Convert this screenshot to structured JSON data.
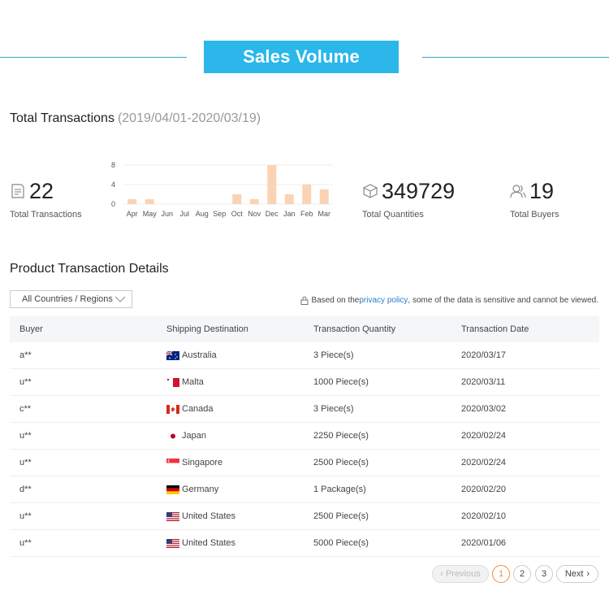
{
  "header": {
    "title": "Sales Volume"
  },
  "transactions": {
    "title": "Total Transactions",
    "date_range": "(2019/04/01-2020/03/19)"
  },
  "stats": {
    "total_transactions": {
      "value": "22",
      "label": "Total Transactions",
      "icon": "document-icon"
    },
    "total_quantities": {
      "value": "349729",
      "label": "Total Quantities",
      "icon": "box-icon"
    },
    "total_buyers": {
      "value": "19",
      "label": "Total Buyers",
      "icon": "users-icon"
    }
  },
  "chart_data": {
    "type": "bar",
    "categories": [
      "Apr",
      "May",
      "Jun",
      "Jul",
      "Aug",
      "Sep",
      "Oct",
      "Nov",
      "Dec",
      "Jan",
      "Feb",
      "Mar"
    ],
    "values": [
      1,
      1,
      0,
      0,
      0,
      0,
      2,
      1,
      8,
      2,
      4,
      3
    ],
    "yticks": [
      "0",
      "4",
      "8"
    ],
    "ylim": [
      0,
      8
    ],
    "grid": true,
    "color": "#fad3b4"
  },
  "details": {
    "title": "Product Transaction Details",
    "region_filter": "All Countries / Regions",
    "privacy": {
      "before": "Based on the ",
      "link": "privacy policy",
      "after": ", some of the data is sensitive and cannot be viewed."
    },
    "columns": [
      "Buyer",
      "Shipping Destination",
      "Transaction Quantity",
      "Transaction Date"
    ],
    "rows": [
      {
        "buyer": "a**",
        "destination": "Australia",
        "flag": "au",
        "quantity": "3 Piece(s)",
        "date": "2020/03/17"
      },
      {
        "buyer": "u**",
        "destination": "Malta",
        "flag": "mt",
        "quantity": "1000 Piece(s)",
        "date": "2020/03/11"
      },
      {
        "buyer": "c**",
        "destination": "Canada",
        "flag": "ca",
        "quantity": "3 Piece(s)",
        "date": "2020/03/02"
      },
      {
        "buyer": "u**",
        "destination": "Japan",
        "flag": "jp",
        "quantity": "2250 Piece(s)",
        "date": "2020/02/24"
      },
      {
        "buyer": "u**",
        "destination": "Singapore",
        "flag": "sg",
        "quantity": "2500 Piece(s)",
        "date": "2020/02/24"
      },
      {
        "buyer": "d**",
        "destination": "Germany",
        "flag": "de",
        "quantity": "1 Package(s)",
        "date": "2020/02/20"
      },
      {
        "buyer": "u**",
        "destination": "United States",
        "flag": "us",
        "quantity": "2500 Piece(s)",
        "date": "2020/02/10"
      },
      {
        "buyer": "u**",
        "destination": "United States",
        "flag": "us",
        "quantity": "5000 Piece(s)",
        "date": "2020/01/06"
      }
    ]
  },
  "pagination": {
    "previous": "Previous",
    "pages": [
      "1",
      "2",
      "3"
    ],
    "current": "1",
    "next": "Next"
  },
  "colors": {
    "accent": "#2bb7ea",
    "link": "#2a7fc9",
    "active_page": "#f08b3a"
  }
}
